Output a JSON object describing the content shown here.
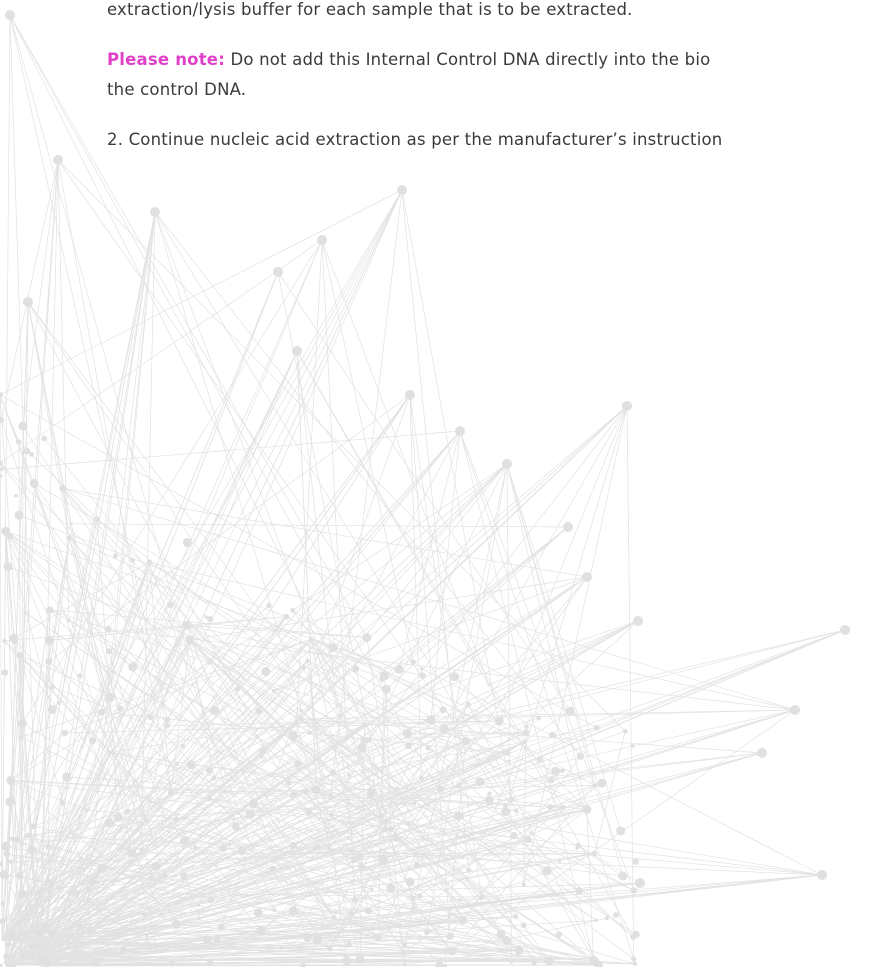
{
  "document": {
    "line_1": "extraction/lysis buffer for each sample that is to be extracted.",
    "note_label": "Please note:",
    "note_text": " Do not add this Internal Control DNA directly into the bio",
    "note_continuation": "the control DNA.",
    "step_2": "2. Continue nucleic acid extraction as per the manufacturer’s instruction"
  },
  "colors": {
    "text": "#3a3a3a",
    "note_label": "#e040c8",
    "network": "#dcdcdc"
  },
  "decoration": {
    "type": "network-illustration"
  }
}
